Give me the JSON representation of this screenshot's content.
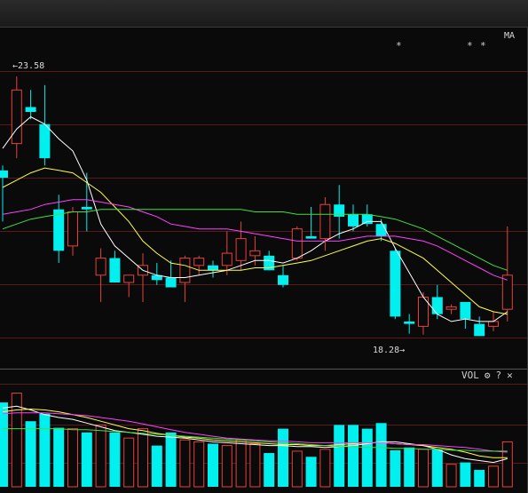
{
  "indicator": {
    "ma_label": "MA",
    "vol_label": "VOL",
    "markers": [
      "*",
      "*",
      "*"
    ]
  },
  "toolbar": {
    "gear_icon": "gear-icon",
    "help_label": "?",
    "close_label": "✕"
  },
  "annotations": {
    "high": "←23.58",
    "low": "18.28→"
  },
  "colors": {
    "up": "#e8403a",
    "down": "#00f0f0",
    "ma5": "#ffffff",
    "ma10": "#ffff40",
    "ma20": "#ff40ff",
    "ma60": "#40e040",
    "grid": "#5a1a1a"
  },
  "chart_data": [
    {
      "type": "candlestick",
      "title": "",
      "ylim": [
        17.6,
        24.6
      ],
      "high_label": 23.58,
      "low_label": 18.28,
      "ohlc": [
        [
          21.65,
          21.75,
          20.6,
          21.5
        ],
        [
          22.2,
          23.58,
          21.9,
          23.3
        ],
        [
          22.95,
          23.3,
          22.7,
          22.85
        ],
        [
          22.6,
          23.4,
          21.75,
          21.9
        ],
        [
          20.85,
          21.15,
          19.75,
          20.0
        ],
        [
          20.1,
          20.9,
          19.9,
          20.8
        ],
        [
          20.9,
          21.6,
          20.4,
          20.85
        ],
        [
          19.5,
          20.05,
          18.95,
          19.85
        ],
        [
          19.85,
          20.0,
          19.4,
          19.35
        ],
        [
          19.35,
          19.5,
          19.05,
          19.5
        ],
        [
          19.5,
          19.95,
          18.95,
          19.7
        ],
        [
          19.5,
          19.75,
          19.3,
          19.4
        ],
        [
          19.45,
          19.8,
          19.35,
          19.25
        ],
        [
          19.35,
          19.9,
          18.95,
          19.85
        ],
        [
          19.7,
          19.9,
          19.5,
          19.85
        ],
        [
          19.7,
          19.8,
          19.45,
          19.6
        ],
        [
          19.7,
          20.4,
          19.5,
          19.95
        ],
        [
          19.8,
          20.6,
          19.6,
          20.25
        ],
        [
          19.9,
          20.3,
          19.7,
          20.0
        ],
        [
          19.9,
          20.0,
          19.6,
          19.6
        ],
        [
          19.5,
          19.7,
          19.25,
          19.3
        ],
        [
          19.85,
          20.5,
          19.8,
          20.45
        ],
        [
          20.3,
          20.9,
          20.3,
          20.25
        ],
        [
          20.25,
          21.1,
          20.0,
          20.95
        ],
        [
          20.95,
          21.35,
          20.25,
          20.7
        ],
        [
          20.75,
          20.95,
          20.4,
          20.5
        ],
        [
          20.75,
          20.95,
          20.5,
          20.55
        ],
        [
          20.55,
          20.65,
          20.2,
          20.3
        ],
        [
          20.0,
          20.05,
          18.6,
          18.65
        ],
        [
          18.55,
          18.7,
          18.3,
          18.5
        ],
        [
          18.45,
          19.15,
          18.28,
          19.05
        ],
        [
          19.05,
          19.3,
          18.6,
          18.7
        ],
        [
          18.8,
          18.9,
          18.7,
          18.85
        ],
        [
          18.95,
          18.95,
          18.4,
          18.6
        ],
        [
          18.5,
          18.65,
          18.25,
          18.25
        ],
        [
          18.45,
          18.75,
          18.35,
          18.55
        ],
        [
          18.8,
          20.5,
          18.55,
          19.5
        ]
      ],
      "ma": [
        {
          "name": "MA5",
          "values": [
            22.1,
            22.5,
            22.75,
            22.6,
            22.3,
            22.05,
            21.45,
            20.55,
            20.1,
            19.85,
            19.6,
            19.5,
            19.45,
            19.45,
            19.5,
            19.55,
            19.6,
            19.7,
            19.8,
            19.8,
            19.75,
            19.85,
            20.0,
            20.2,
            20.35,
            20.45,
            20.6,
            20.6,
            20.05,
            19.55,
            19.05,
            18.7,
            18.55,
            18.6,
            18.55,
            18.55,
            18.75
          ]
        },
        {
          "name": "MA10",
          "values": [
            21.3,
            21.45,
            21.6,
            21.7,
            21.65,
            21.6,
            21.4,
            21.2,
            20.9,
            20.6,
            20.2,
            19.95,
            19.75,
            19.7,
            19.6,
            19.6,
            19.6,
            19.6,
            19.65,
            19.65,
            19.7,
            19.75,
            19.8,
            19.9,
            20.0,
            20.1,
            20.2,
            20.25,
            20.15,
            20.0,
            19.85,
            19.6,
            19.35,
            19.1,
            18.85,
            18.75,
            18.7
          ]
        },
        {
          "name": "MA20",
          "values": [
            20.75,
            20.8,
            20.85,
            20.95,
            21.0,
            21.05,
            21.05,
            21.0,
            20.95,
            20.9,
            20.8,
            20.7,
            20.55,
            20.5,
            20.45,
            20.45,
            20.45,
            20.4,
            20.35,
            20.3,
            20.25,
            20.2,
            20.2,
            20.2,
            20.2,
            20.25,
            20.3,
            20.3,
            20.3,
            20.25,
            20.2,
            20.1,
            19.95,
            19.8,
            19.65,
            19.5,
            19.4
          ]
        },
        {
          "name": "MA60",
          "values": [
            20.45,
            20.55,
            20.65,
            20.7,
            20.75,
            20.8,
            20.8,
            20.85,
            20.85,
            20.85,
            20.85,
            20.85,
            20.85,
            20.85,
            20.85,
            20.85,
            20.85,
            20.85,
            20.8,
            20.8,
            20.8,
            20.75,
            20.75,
            20.75,
            20.75,
            20.75,
            20.75,
            20.7,
            20.65,
            20.55,
            20.45,
            20.3,
            20.15,
            20.0,
            19.85,
            19.7,
            19.6
          ]
        }
      ]
    },
    {
      "type": "bar",
      "title": "VOL",
      "ylim": [
        0,
        110
      ],
      "values": [
        90,
        100,
        70,
        78,
        63,
        62,
        58,
        66,
        58,
        52,
        62,
        44,
        58,
        50,
        48,
        46,
        44,
        50,
        46,
        36,
        62,
        38,
        32,
        40,
        66,
        66,
        62,
        68,
        39,
        42,
        40,
        40,
        24,
        26,
        18,
        22,
        48
      ],
      "ma": [
        {
          "name": "MA5",
          "values": [
            84,
            86,
            82,
            77,
            74,
            72,
            68,
            64,
            60,
            58,
            56,
            54,
            53,
            52,
            50,
            48,
            47,
            46,
            45,
            44,
            44,
            43,
            43,
            42,
            43,
            44,
            46,
            48,
            48,
            46,
            44,
            40,
            34,
            30,
            28,
            26,
            30
          ]
        },
        {
          "name": "MA10",
          "values": [
            80,
            82,
            83,
            82,
            80,
            77,
            74,
            70,
            66,
            62,
            60,
            57,
            55,
            53,
            52,
            50,
            49,
            48,
            47,
            46,
            45,
            45,
            44,
            44,
            45,
            46,
            47,
            47,
            46,
            45,
            44,
            42,
            40,
            37,
            33,
            31,
            31
          ]
        },
        {
          "name": "MA20",
          "values": [
            78,
            79,
            79,
            79,
            78,
            77,
            76,
            74,
            72,
            70,
            67,
            64,
            61,
            58,
            56,
            54,
            52,
            51,
            50,
            49,
            49,
            48,
            47,
            47,
            47,
            47,
            47,
            47,
            46,
            45,
            45,
            44,
            43,
            42,
            40,
            38,
            37
          ]
        },
        {
          "name": "MA60",
          "values": [
            62,
            62,
            62,
            62,
            62,
            61,
            61,
            60,
            59,
            58,
            57,
            56,
            55,
            54,
            53,
            52,
            51,
            50,
            49,
            48,
            47,
            46,
            45,
            44,
            43,
            43,
            42,
            42,
            41,
            41,
            40,
            40,
            39,
            39,
            38,
            38,
            38
          ]
        }
      ]
    }
  ]
}
